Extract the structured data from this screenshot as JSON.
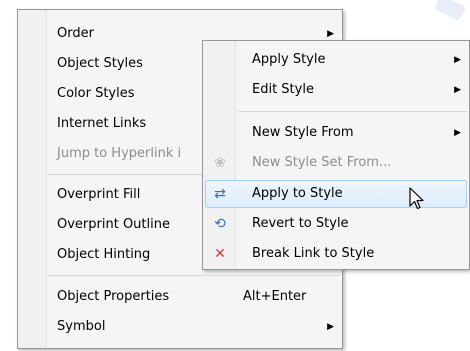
{
  "main_menu": {
    "items": [
      {
        "label": "Order",
        "submenu": true
      },
      {
        "label": "Object Styles",
        "submenu": false
      },
      {
        "label": "Color Styles",
        "submenu": false
      },
      {
        "label": "Internet Links",
        "submenu": false
      },
      {
        "label": "Jump to Hyperlink i",
        "submenu": false,
        "disabled": true
      },
      {
        "label": "Overprint Fill"
      },
      {
        "label": "Overprint Outline"
      },
      {
        "label": "Object Hinting"
      },
      {
        "label": "Object Properties",
        "shortcut": "Alt+Enter"
      },
      {
        "label": "Symbol",
        "submenu": true
      }
    ]
  },
  "sub_menu": {
    "items": [
      {
        "label": "Apply Style",
        "submenu": true
      },
      {
        "label": "Edit Style",
        "submenu": true
      },
      {
        "label": "New Style From",
        "submenu": true
      },
      {
        "label": "New Style Set From...",
        "disabled": true
      },
      {
        "label": "Apply to Style",
        "highlighted": true
      },
      {
        "label": "Revert to Style"
      },
      {
        "label": "Break Link to Style"
      }
    ]
  },
  "glyphs": {
    "submenu_arrow": "▶",
    "icon_apply": "⇄",
    "icon_revert": "⟲",
    "icon_break": "✕",
    "icon_new_set": "❀"
  },
  "decoration": {
    "corner_text": "R"
  },
  "colors": {
    "menu_bg": "#f5f5f5",
    "gutter_bg": "#f1f1f1",
    "highlight_bg": "#ddecfc",
    "highlight_border": "#aecff7",
    "disabled_text": "#8d8d8d",
    "break_icon": "#d83b3b"
  }
}
